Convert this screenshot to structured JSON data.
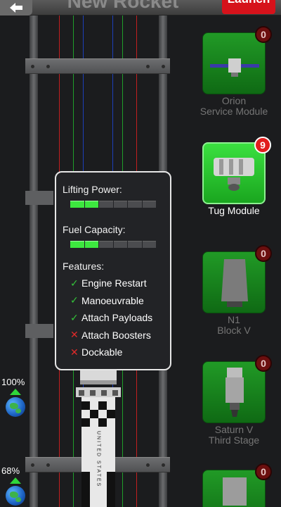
{
  "header": {
    "title": "New Rocket",
    "launch_label": "Launch"
  },
  "colors": {
    "module_green": "#1f9a24",
    "badge_red": "#e11e1e",
    "bar_green": "#3de83f",
    "popup_border": "#e6e6e6"
  },
  "progress": [
    {
      "label": "100%",
      "value": 100,
      "icon": "earth-icon"
    },
    {
      "label": "68%",
      "value": 68,
      "icon": "earth-icon"
    }
  ],
  "modules": [
    {
      "name": "Orion\nService Module",
      "count": "0",
      "selected": false
    },
    {
      "name": "Tug Module",
      "count": "9",
      "selected": true
    },
    {
      "name": "N1\nBlock V",
      "count": "0",
      "selected": false
    },
    {
      "name": "Saturn V\nThird Stage",
      "count": "0",
      "selected": false
    },
    {
      "name": "",
      "count": "0",
      "selected": false
    }
  ],
  "popup": {
    "lifting_label": "Lifting Power:",
    "lifting_level": 0.33,
    "fuel_label": "Fuel Capacity:",
    "fuel_level": 0.33,
    "features_label": "Features:",
    "features": [
      {
        "label": "Engine Restart",
        "enabled": true
      },
      {
        "label": "Manoeuvrable",
        "enabled": true
      },
      {
        "label": "Attach Payloads",
        "enabled": true
      },
      {
        "label": "Attach Boosters",
        "enabled": false
      },
      {
        "label": "Dockable",
        "enabled": false
      }
    ]
  },
  "rocket": {
    "markings": "UNITED STATES"
  }
}
